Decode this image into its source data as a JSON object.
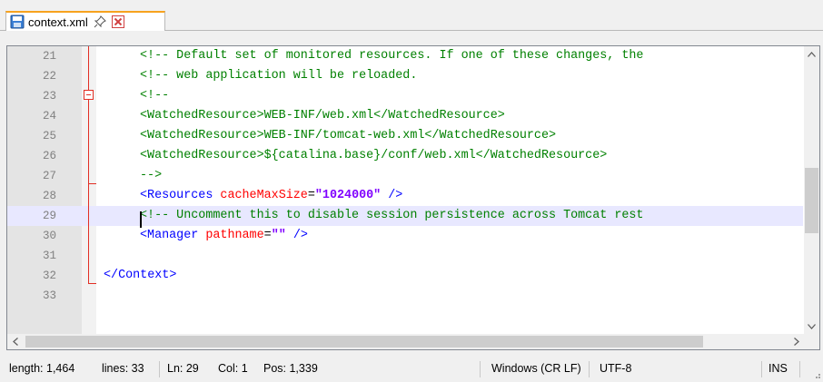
{
  "tab": {
    "label": "context.xml"
  },
  "editor": {
    "current_line": 29,
    "lines": [
      {
        "n": "21",
        "tokens": [
          {
            "c": "comment",
            "t": "<!-- Default set of monitored resources. If one of these changes, the"
          }
        ]
      },
      {
        "n": "22",
        "tokens": [
          {
            "c": "comment",
            "t": "<!-- web application will be reloaded."
          }
        ]
      },
      {
        "n": "23",
        "tokens": [
          {
            "c": "comment",
            "t": "<!--"
          }
        ]
      },
      {
        "n": "24",
        "tokens": [
          {
            "c": "comment",
            "t": "<WatchedResource>WEB-INF/web.xml</WatchedResource>"
          }
        ]
      },
      {
        "n": "25",
        "tokens": [
          {
            "c": "comment",
            "t": "<WatchedResource>WEB-INF/tomcat-web.xml</WatchedResource>"
          }
        ]
      },
      {
        "n": "26",
        "tokens": [
          {
            "c": "comment",
            "t": "<WatchedResource>${catalina.base}/conf/web.xml</WatchedResource>"
          }
        ]
      },
      {
        "n": "27",
        "tokens": [
          {
            "c": "comment",
            "t": "-->"
          }
        ]
      },
      {
        "n": "28",
        "tokens": [
          {
            "c": "tag",
            "t": "<Resources"
          },
          {
            "c": "plain",
            "t": " "
          },
          {
            "c": "attr",
            "t": "cacheMaxSize"
          },
          {
            "c": "plain",
            "t": "="
          },
          {
            "c": "val",
            "t": "\"1024000\""
          },
          {
            "c": "plain",
            "t": " "
          },
          {
            "c": "tag",
            "t": "/>"
          }
        ]
      },
      {
        "n": "29",
        "tokens": [
          {
            "c": "comment",
            "t": "<!-- Uncomment this to disable session persistence across Tomcat rest"
          }
        ]
      },
      {
        "n": "30",
        "tokens": [
          {
            "c": "tag",
            "t": "<Manager"
          },
          {
            "c": "plain",
            "t": " "
          },
          {
            "c": "attr",
            "t": "pathname"
          },
          {
            "c": "plain",
            "t": "="
          },
          {
            "c": "val",
            "t": "\"\""
          },
          {
            "c": "plain",
            "t": " "
          },
          {
            "c": "tag",
            "t": "/>"
          }
        ]
      },
      {
        "n": "31",
        "tokens": []
      },
      {
        "n": "32",
        "depth0": true,
        "tokens": [
          {
            "c": "tag",
            "t": "</Context>"
          }
        ]
      },
      {
        "n": "33",
        "tokens": []
      }
    ]
  },
  "status": {
    "length": "length: 1,464",
    "lines": "lines: 33",
    "ln": "Ln: 29",
    "col": "Col: 1",
    "pos": "Pos: 1,339",
    "eol": "Windows (CR LF)",
    "encoding": "UTF-8",
    "mode": "INS"
  },
  "colors": {
    "comment": "#008000",
    "tag": "#0000ff",
    "attr": "#ff0000",
    "value": "#8000ff",
    "fold_marker": "#e22f25",
    "tab_accent": "#f7a21e",
    "current_line_bg": "#e8e8ff"
  }
}
